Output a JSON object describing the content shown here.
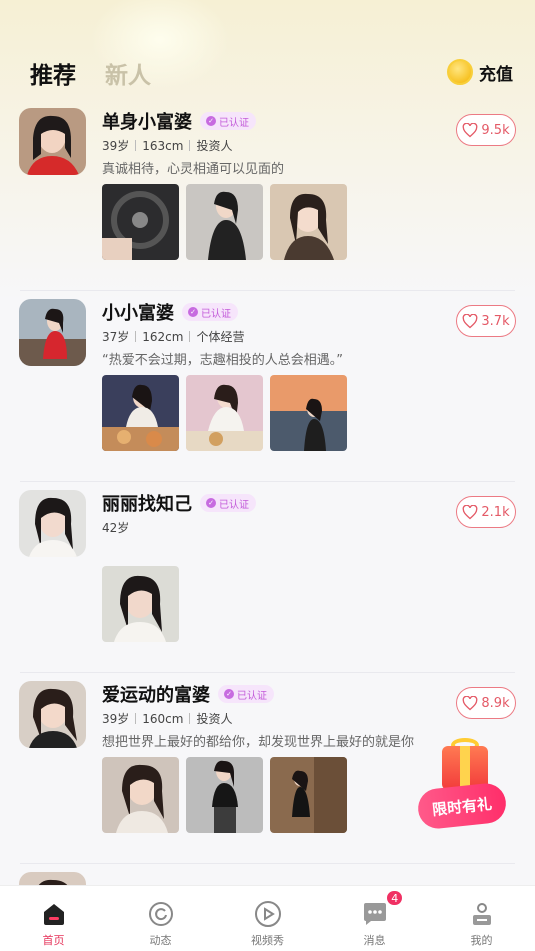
{
  "header": {
    "tab_recommend": "推荐",
    "tab_new": "新人",
    "recharge_label": "充值"
  },
  "verified_label": "已认证",
  "cards": [
    {
      "name": "单身小富婆",
      "age": "39岁",
      "height": "163cm",
      "job": "投资人",
      "bio": "真诚相待，心灵相通可以见面的",
      "likes": "9.5k"
    },
    {
      "name": "小小富婆",
      "age": "37岁",
      "height": "162cm",
      "job": "个体经营",
      "bio": "“热爱不会过期，志趣相投的人总会相遇。”",
      "likes": "3.7k"
    },
    {
      "name": "丽丽找知己",
      "age": "42岁",
      "height": "",
      "job": "",
      "bio": "",
      "likes": "2.1k"
    },
    {
      "name": "爱运动的富婆",
      "age": "39岁",
      "height": "160cm",
      "job": "投资人",
      "bio": "想把世界上最好的都给你，却发现世界上最好的就是你",
      "likes": "8.9k"
    }
  ],
  "promo": {
    "label": "限时有礼"
  },
  "tabbar": {
    "items": [
      "首页",
      "动态",
      "视频秀",
      "消息",
      "我的"
    ],
    "messages_badge": "4"
  },
  "colors": {
    "accent": "#e5335a",
    "like": "#e45a67",
    "verified": "#c35bd9"
  }
}
